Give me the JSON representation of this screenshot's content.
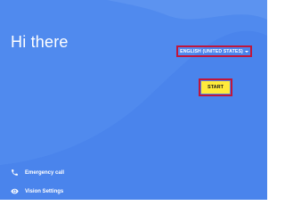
{
  "screen": {
    "greeting": "Hi there"
  },
  "language": {
    "selected": "ENGLISH (UNITED STATES)"
  },
  "start_button": {
    "label": "START"
  },
  "footer": {
    "emergency_label": "Emergency call",
    "vision_label": "Vision Settings"
  },
  "colors": {
    "background": "#4a84ec",
    "accent_highlight": "#c0163b",
    "start_button": "#ffeb3b",
    "text": "#ffffff"
  },
  "icons": {
    "language_dropdown": "chevron-down-icon",
    "emergency": "phone-icon",
    "vision": "eye-icon"
  }
}
